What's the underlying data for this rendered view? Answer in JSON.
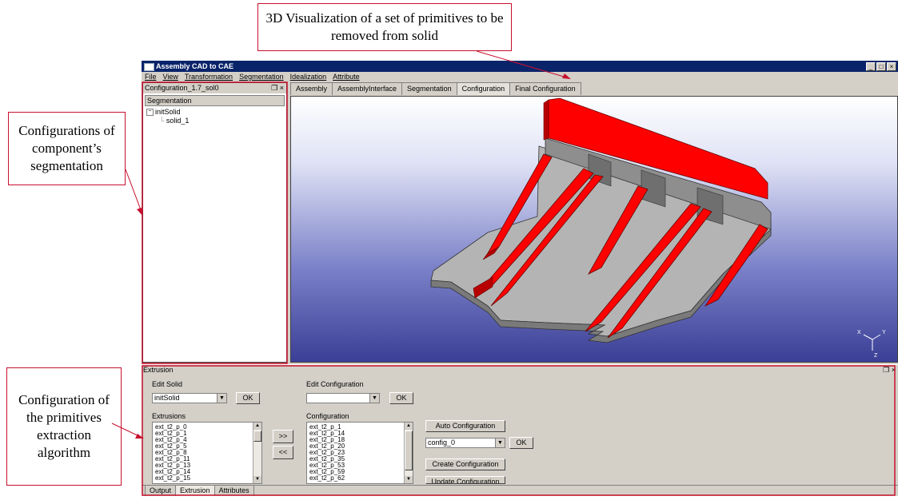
{
  "callouts": {
    "top": "3D Visualization of a set of primitives to be removed from solid",
    "left": "Configurations of component’s segmentation",
    "bottom_left": "Configuration of the primitives extraction algorithm"
  },
  "window": {
    "title": "Assembly CAD to CAE",
    "buttons": [
      "_",
      "□",
      "×"
    ]
  },
  "menu": [
    "File",
    "View",
    "Transformation",
    "Segmentation",
    "Idealization",
    "Attribute"
  ],
  "left_panel": {
    "title": "Configuration_1.7_sol0",
    "header": "Segmentation",
    "tree": [
      {
        "label": "initSolid",
        "expander": "⊟"
      },
      {
        "label": "solid_1"
      }
    ]
  },
  "view_tabs": [
    "Assembly",
    "AssemblyInterface",
    "Segmentation",
    "Configuration",
    "Final Configuration"
  ],
  "active_view_tab": "Configuration",
  "axis_labels": {
    "x": "X",
    "y": "Y",
    "z": "Z"
  },
  "extrusion_panel": {
    "title": "Extrusion",
    "edit_solid": {
      "label": "Edit Solid",
      "value": "initSolid",
      "ok": "OK"
    },
    "edit_configuration": {
      "label": "Edit Configuration",
      "value": "",
      "ok": "OK"
    },
    "extrusions": {
      "label": "Extrusions",
      "items": [
        "ext_t2_p_0",
        "ext_t2_p_1",
        "ext_t2_p_4",
        "ext_t2_p_5",
        "ext_t2_p_8",
        "ext_t2_p_11",
        "ext_t2_p_13",
        "ext_t2_p_14",
        "ext_t2_p_15"
      ]
    },
    "move_right": ">>",
    "move_left": "<<",
    "configuration": {
      "label": "Configuration",
      "items": [
        "ext_t2_p_1",
        "ext_t2_p_14",
        "ext_t2_p_18",
        "ext_t2_p_20",
        "ext_t2_p_23",
        "ext_t2_p_35",
        "ext_t2_p_53",
        "ext_t2_p_59",
        "ext_t2_p_62"
      ]
    },
    "auto_configuration": "Auto Configuration",
    "config_select": {
      "value": "config_0",
      "ok": "OK"
    },
    "create_configuration": "Create Configuration",
    "update_configuration": "Update Configuration"
  },
  "bottom_tabs": [
    "Output",
    "Extrusion",
    "Attributes"
  ],
  "active_bottom_tab": "Extrusion",
  "colors": {
    "primitive": "#ff0000",
    "solid": "#a8a8a8",
    "accent_line": "#c8102e",
    "titlebar": "#0a246a"
  }
}
